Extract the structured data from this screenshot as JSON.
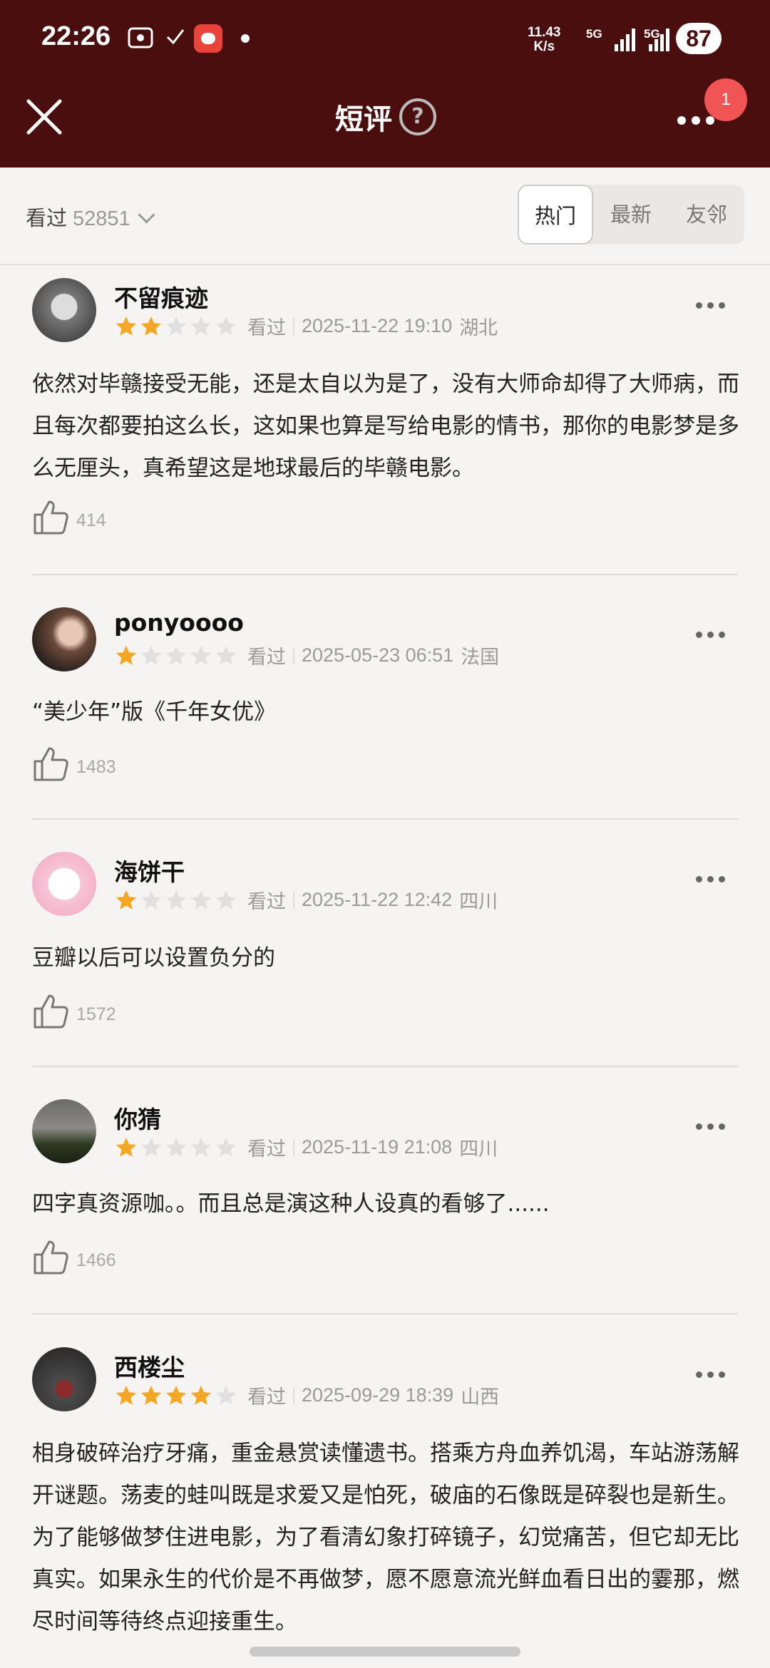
{
  "status": {
    "time": "22:26",
    "speed": "11.43",
    "speed_unit": "K/s",
    "net1": "5G",
    "net2": "5G",
    "battery": "87"
  },
  "header": {
    "title": "短评",
    "help_icon": "?",
    "badge": "1"
  },
  "filter": {
    "label": "看过",
    "count": "52851",
    "tabs": [
      "热门",
      "最新",
      "友邻"
    ],
    "active_tab": 0
  },
  "colors": {
    "bar": "#4a0e0e",
    "star_on": "#f5a623",
    "star_off": "#e0e0e0",
    "badge": "#f05454"
  },
  "reviews": [
    {
      "name": "不留痕迹",
      "stars": 2,
      "status": "看过",
      "datetime": "2025-11-22 19:10",
      "location": "湖北",
      "text": "依然对毕赣接受无能，还是太自以为是了，没有大师命却得了大师病，而且每次都要拍这么长，这如果也算是写给电影的情书，那你的电影梦是多么无厘头，真希望这是地球最后的毕赣电影。",
      "likes": "414"
    },
    {
      "name": "ponyoooo",
      "stars": 1,
      "status": "看过",
      "datetime": "2025-05-23 06:51",
      "location": "法国",
      "text": "“美少年”版《千年女优》",
      "likes": "1483"
    },
    {
      "name": "海饼干",
      "stars": 1,
      "status": "看过",
      "datetime": "2025-11-22 12:42",
      "location": "四川",
      "text": "豆瓣以后可以设置负分的",
      "likes": "1572"
    },
    {
      "name": "你猜",
      "stars": 1,
      "status": "看过",
      "datetime": "2025-11-19 21:08",
      "location": "四川",
      "text": "四字真资源咖。。而且总是演这种人设真的看够了......",
      "likes": "1466"
    },
    {
      "name": "西楼尘",
      "stars": 4,
      "status": "看过",
      "datetime": "2025-09-29 18:39",
      "location": "山西",
      "text": "相身破碎治疗牙痛，重金悬赏读懂遗书。搭乘方舟血养饥渴，车站游荡解开谜题。荡麦的蛙叫既是求爱又是怕死，破庙的石像既是碎裂也是新生。为了能够做梦住进电影，为了看清幻象打碎镜子，幻觉痛苦，但它却无比真实。如果永生的代价是不再做梦，愿不愿意流光鲜血看日出的霎那，燃尽时间等待终点迎接重生。",
      "likes": ""
    }
  ]
}
